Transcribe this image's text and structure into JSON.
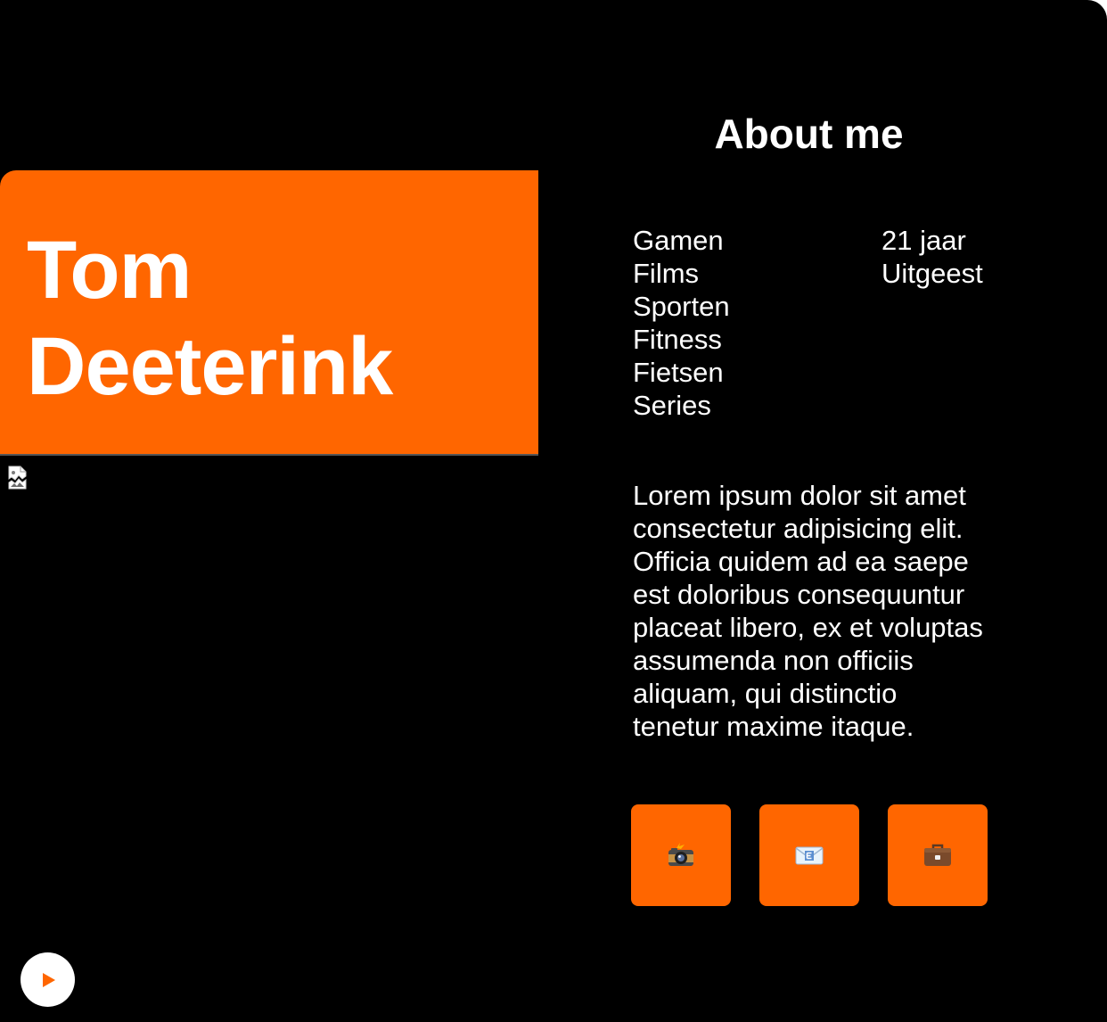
{
  "profile": {
    "name": "Tom Deeterink"
  },
  "about": {
    "title": "About me",
    "hobbies": [
      "Gamen",
      "Films",
      "Sporten",
      "Fitness",
      "Fietsen",
      "Series"
    ],
    "facts": [
      "21 jaar",
      "Uitgeest"
    ],
    "bio": "Lorem ipsum dolor sit amet consectetur adipisicing elit. Officia quidem ad ea saepe est doloribus consequuntur placeat libero, ex et voluptas assumenda non officiis aliquam, qui distinctio tenetur maxime itaque."
  },
  "social_links": [
    {
      "icon": "camera-with-flash-icon"
    },
    {
      "icon": "email-icon"
    },
    {
      "icon": "briefcase-icon"
    }
  ],
  "media": {
    "image_state": "broken-image",
    "play_icon": "play-icon"
  },
  "colors": {
    "background": "#000000",
    "accent": "#ff6600",
    "text": "#ffffff"
  }
}
